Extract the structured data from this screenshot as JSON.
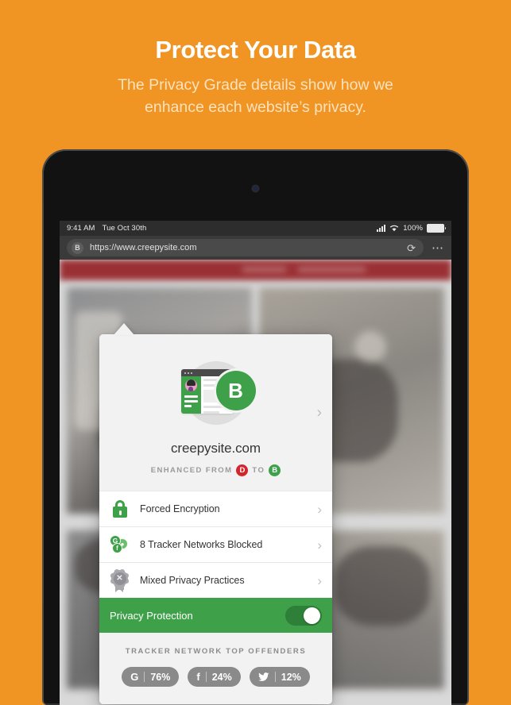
{
  "promo": {
    "title": "Protect Your Data",
    "subtitle": "The Privacy Grade details show how we enhance each website’s privacy."
  },
  "colors": {
    "background_orange": "#F09423",
    "brand_green": "#3FA04A",
    "grade_d_red": "#D2262C",
    "toggle_track": "#2E7F38",
    "pill_gray": "#8A8A8A",
    "popover_header": "#F2F2F2"
  },
  "device": {
    "statusbar": {
      "time": "9:41 AM",
      "date": "Tue Oct 30th",
      "battery_percent": "100%",
      "signal_icon": "cellular-signal-icon",
      "wifi_icon": "wifi-icon",
      "battery_icon": "battery-full-icon"
    },
    "urlbar": {
      "grade_chip": "B",
      "url": "https://www.creepysite.com",
      "reload_icon": "reload-icon",
      "menu_icon": "more-options-icon"
    }
  },
  "popover": {
    "header": {
      "illustration_icon": "privacy-grade-illustration",
      "grade_letter": "B",
      "site_name": "creepysite.com",
      "enhanced_prefix": "ENHANCED FROM",
      "enhanced_from": "D",
      "enhanced_join": "TO",
      "enhanced_to": "B",
      "chevron_icon": "chevron-right-icon"
    },
    "rows": [
      {
        "icon": "lock-icon",
        "label": "Forced Encryption",
        "chevron": "chevron-right-icon"
      },
      {
        "icon": "tracker-networks-icon",
        "label": "8 Tracker Networks Blocked",
        "chevron": "chevron-right-icon"
      },
      {
        "icon": "privacy-practices-badge-icon",
        "label": "Mixed Privacy Practices",
        "chevron": "chevron-right-icon"
      }
    ],
    "protection": {
      "label": "Privacy Protection",
      "toggle_state": "on"
    },
    "offenders": {
      "title": "TRACKER NETWORK TOP OFFENDERS",
      "items": [
        {
          "icon": "google-icon",
          "glyph": "G",
          "percent": "76%"
        },
        {
          "icon": "facebook-icon",
          "glyph": "f",
          "percent": "24%"
        },
        {
          "icon": "twitter-icon",
          "glyph": "ᴗ",
          "percent": "12%"
        }
      ]
    }
  }
}
